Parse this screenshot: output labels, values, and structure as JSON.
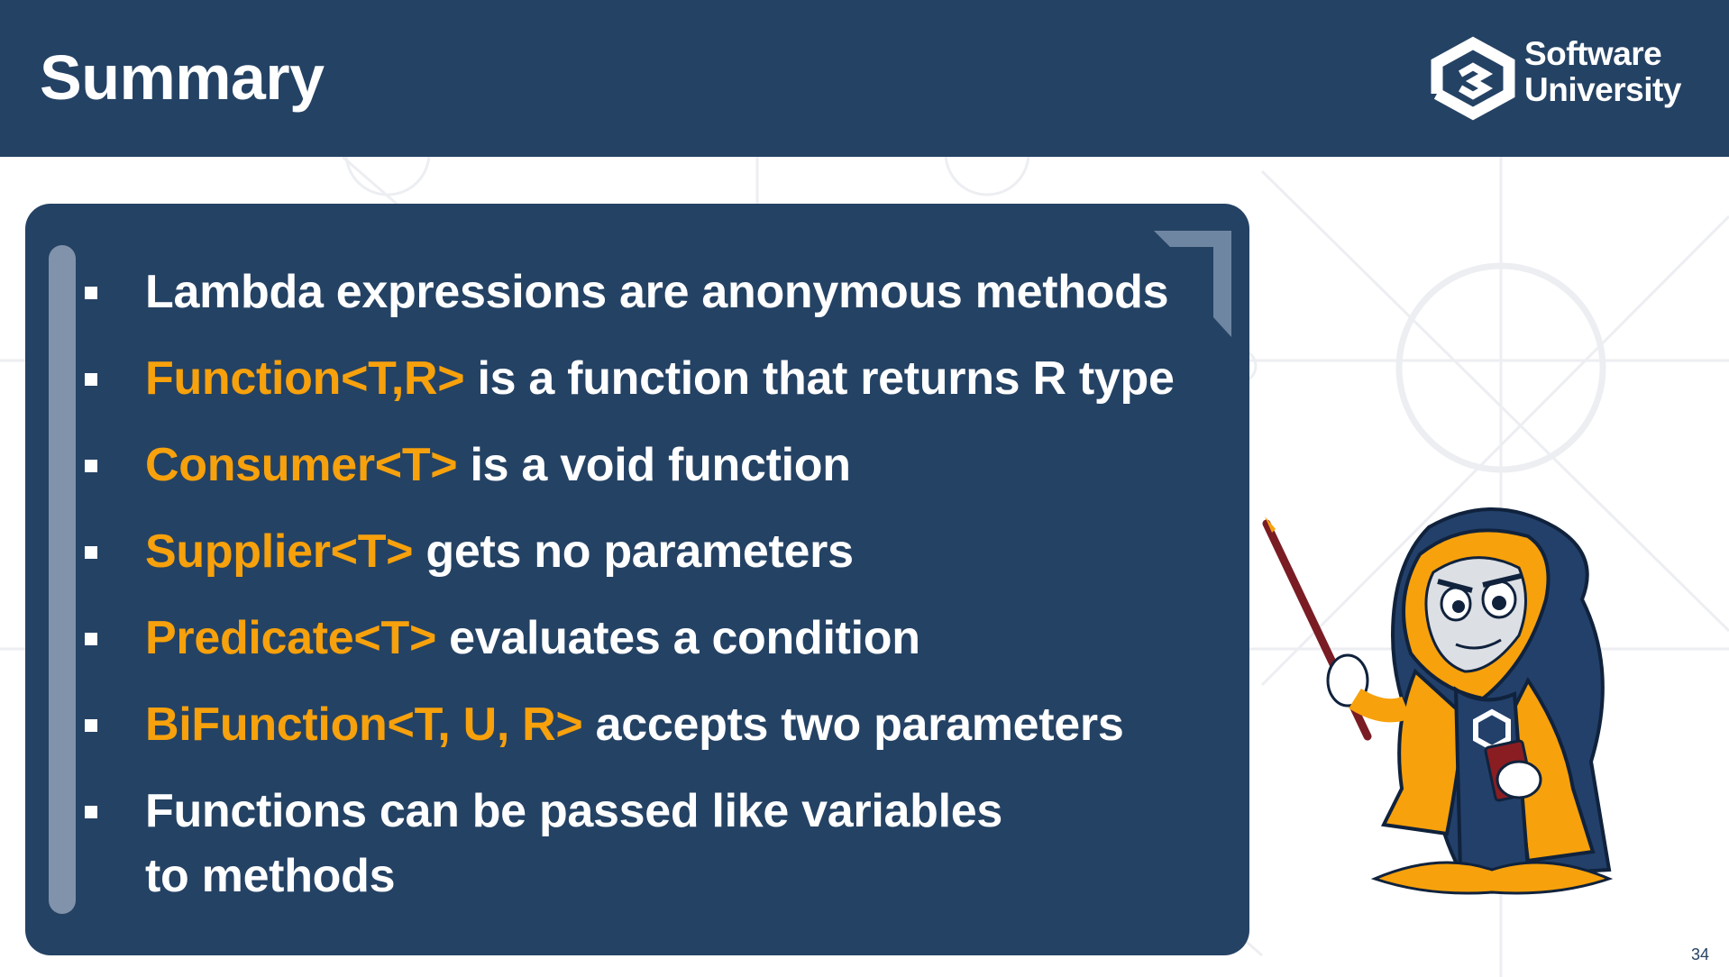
{
  "slide": {
    "title": "Summary",
    "page_number": "34"
  },
  "logo": {
    "line1": "Software",
    "line2": "University"
  },
  "bullets": [
    {
      "highlight": "",
      "text": "Lambda expressions are anonymous methods"
    },
    {
      "highlight": "Function<T,R>",
      "text": " is a function that returns R type"
    },
    {
      "highlight": "Consumer<T>",
      "text": " is a void function"
    },
    {
      "highlight": "Supplier<T>",
      "text": " gets no parameters"
    },
    {
      "highlight": "Predicate<T>",
      "text": " evaluates a condition"
    },
    {
      "highlight": "BiFunction<T, U, R>",
      "text": " accepts two parameters"
    },
    {
      "highlight": "",
      "text": "Functions can be passed like variables",
      "text2": "to methods"
    }
  ],
  "colors": {
    "header_bg": "#244264",
    "panel_bg": "#244264",
    "highlight": "#f7a10c",
    "text": "#ffffff"
  },
  "icons": {
    "logo": "softuni-logo-icon",
    "bullet": "square-bullet-icon",
    "mascot": "wizard-mascot-icon"
  }
}
